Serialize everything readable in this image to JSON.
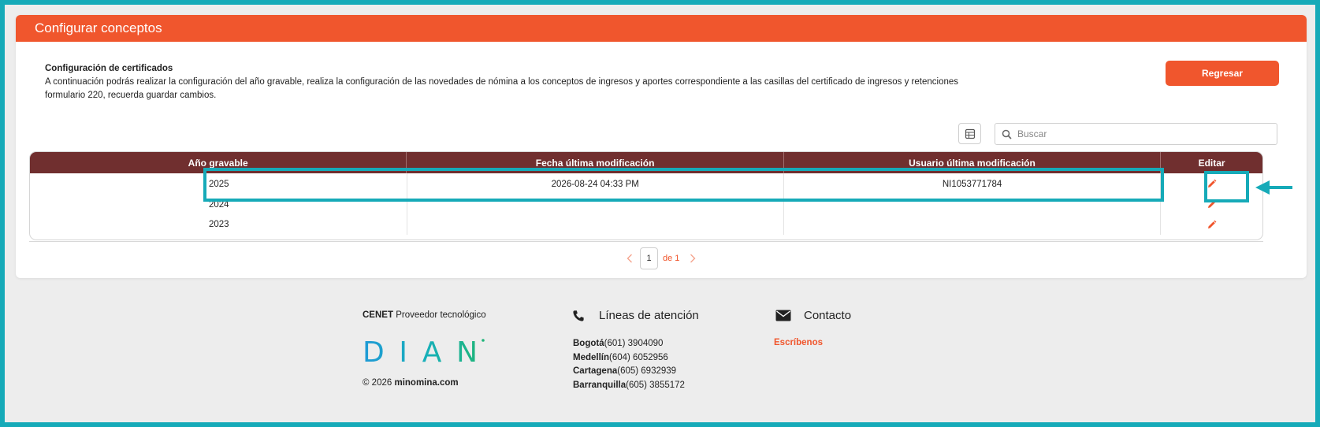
{
  "header": {
    "title": "Configurar conceptos"
  },
  "intro": {
    "title": "Configuración de certificados",
    "text": "A continuación podrás realizar la configuración del año gravable, realiza la configuración de las novedades de nómina a los conceptos de ingresos y aportes correspondiente a las casillas del certificado de ingresos y retenciones formulario 220, recuerda guardar cambios."
  },
  "buttons": {
    "back_label": "Regresar"
  },
  "search": {
    "placeholder": "Buscar",
    "value": ""
  },
  "table": {
    "columns": [
      "Año gravable",
      "Fecha última modificación",
      "Usuario última modificación",
      "Editar"
    ],
    "rows": [
      {
        "year": "2025",
        "modified": "2026-08-24 04:33 PM",
        "user": "NI1053771784"
      },
      {
        "year": "2024",
        "modified": "",
        "user": ""
      },
      {
        "year": "2023",
        "modified": "",
        "user": ""
      }
    ]
  },
  "pagination": {
    "current": "1",
    "of_label": "de",
    "total": "1"
  },
  "footer": {
    "provider_brand": "CENET",
    "provider_text": "Proveedor tecnológico",
    "logo_text": "DIAN",
    "copyright_prefix": "© 2026",
    "copyright_site": "minomina.com",
    "lines_title": "Líneas de atención",
    "phones": [
      {
        "city": "Bogotá",
        "number": "(601) 3904090"
      },
      {
        "city": "Medellín",
        "number": "(604) 6052956"
      },
      {
        "city": "Cartagena",
        "number": "(605) 6932939"
      },
      {
        "city": "Barranquilla",
        "number": "(605) 3855172"
      }
    ],
    "contact_title": "Contacto",
    "contact_link": "Escríbenos"
  },
  "colors": {
    "accent": "#f0562d",
    "table_header": "#702f2f",
    "annotation": "#16aab8"
  }
}
